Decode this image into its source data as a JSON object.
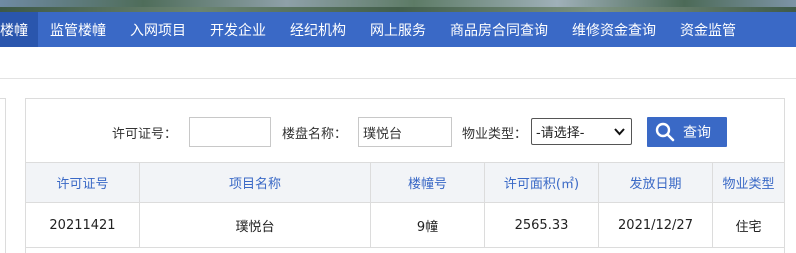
{
  "nav": {
    "items": [
      "楼幢",
      "监管楼幢",
      "入网项目",
      "开发企业",
      "经纪机构",
      "网上服务",
      "商品房合同查询",
      "维修资金查询",
      "资金监管"
    ]
  },
  "search": {
    "permit_label": "许可证号：",
    "permit_value": "",
    "estate_label": "楼盘名称：",
    "estate_value": "璞悦台",
    "type_label": "物业类型：",
    "type_selected": "-请选择-",
    "button_label": "查询"
  },
  "table": {
    "headers": [
      "许可证号",
      "项目名称",
      "楼幢号",
      "许可面积(㎡)",
      "发放日期",
      "物业类型"
    ],
    "rows": [
      [
        "20211421",
        "璞悦台",
        "9幢",
        "2565.33",
        "2021/12/27",
        "住宅"
      ]
    ]
  },
  "colors": {
    "primary": "#3a69c6",
    "nav_active": "#2a56ad",
    "header_bg": "#f2f4f7"
  },
  "icons": {
    "search_button": "search-icon",
    "select_arrow": "chevron-down-icon"
  }
}
